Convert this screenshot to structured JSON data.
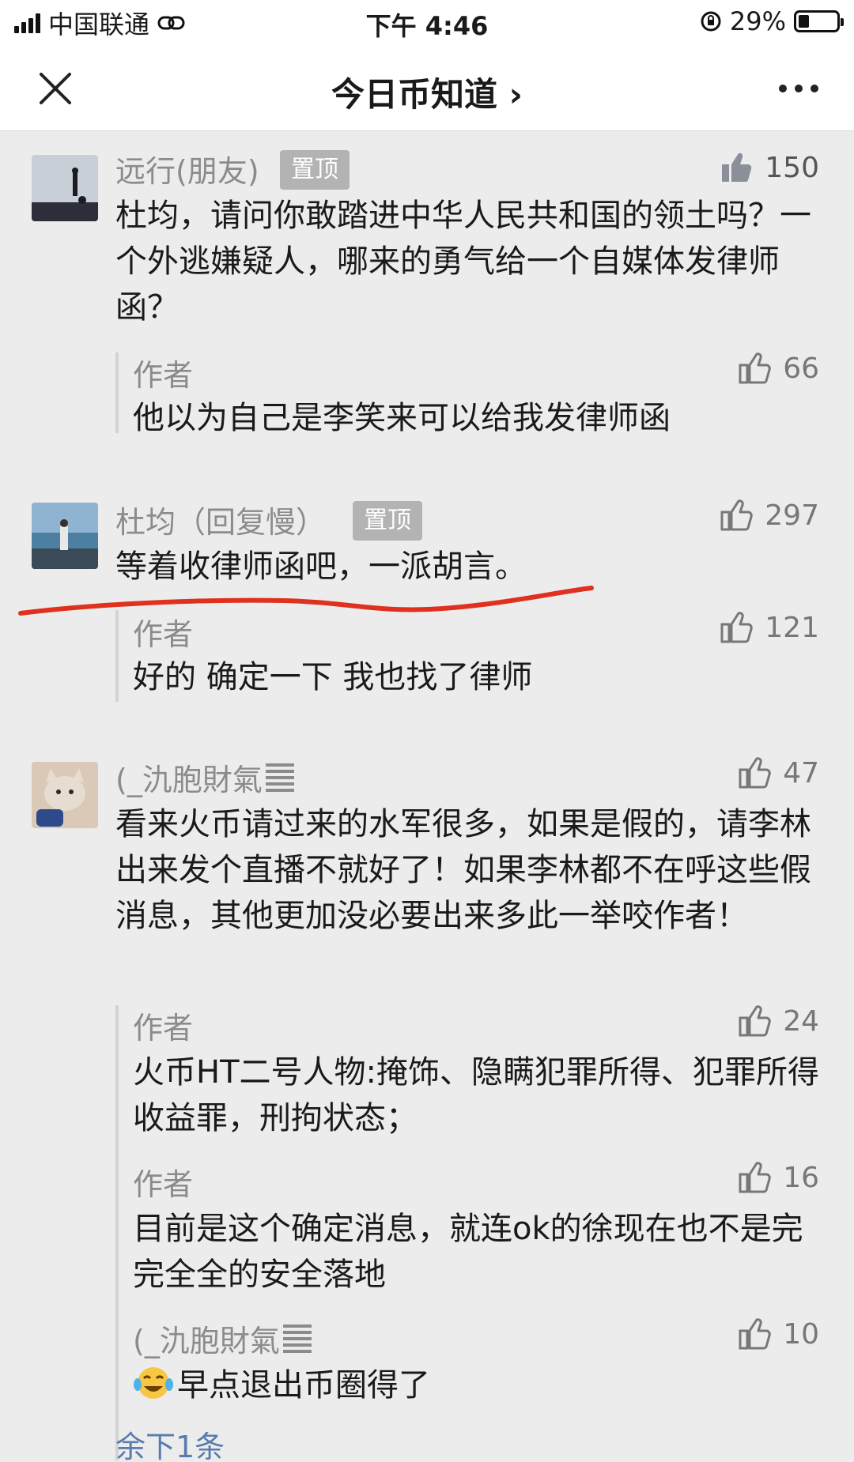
{
  "status_bar": {
    "carrier": "中国联通",
    "time": "下午 4:46",
    "battery": "29%",
    "battery_level": 0.29
  },
  "nav": {
    "title": "今日币知道 ›"
  },
  "comments": [
    {
      "name": "远行(朋友)",
      "pin": "置顶",
      "likes": "150",
      "liked": true,
      "text": "杜均，请问你敢踏进中华人民共和国的领土吗？一个外逃嫌疑人，哪来的勇气给一个自媒体发律师函？",
      "replies": [
        {
          "name": "作者",
          "likes": "66",
          "text": "他以为自己是李笑来可以给我发律师函"
        }
      ]
    },
    {
      "name": "杜均（回复慢）",
      "pin": "置顶",
      "likes": "297",
      "text": "等着收律师函吧，一派胡言。",
      "replies": [
        {
          "name": "作者",
          "likes": "121",
          "text": "好的 确定一下 我也找了律师"
        }
      ]
    },
    {
      "name": "(_氿胞財氣",
      "likes": "47",
      "text": "看来火币请过来的水军很多，如果是假的，请李林出来发个直播不就好了！如果李林都不在呼这些假消息，其他更加没必要出来多此一举咬作者！",
      "replies": [
        {
          "name": "作者",
          "likes": "24",
          "text": "火币HT二号人物:掩饰、隐瞒犯罪所得、犯罪所得收益罪，刑拘状态；"
        },
        {
          "name": "作者",
          "likes": "16",
          "text": "目前是这个确定消息，就连ok的徐现在也不是完完全全的安全落地"
        },
        {
          "name": "(_氿胞財氣",
          "likes": "10",
          "emoji": "crying-laughing-icon",
          "text": "早点退出币圈得了"
        }
      ],
      "more": "余下1条"
    }
  ],
  "colors": {
    "annotation_underline": "#e0301e",
    "link": "#5a7cae",
    "pin_badge": "#b3b3b3"
  }
}
